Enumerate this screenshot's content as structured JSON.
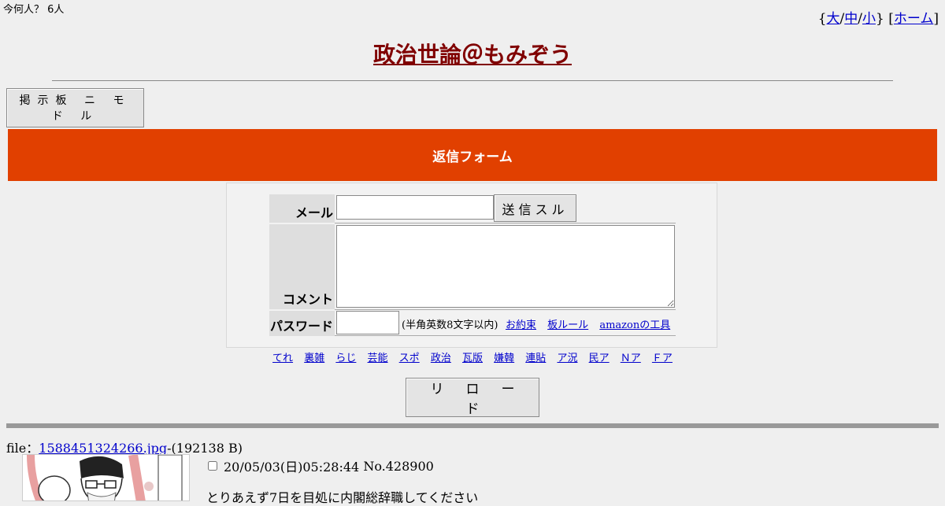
{
  "counter": {
    "text": "今何人？ 6人"
  },
  "top_nav": {
    "open_brace": "{",
    "size_large": "大",
    "sep1": "/",
    "size_medium": "中",
    "sep2": "/",
    "size_small": "小",
    "close_brace": "}",
    "open_bracket": "[",
    "home": "ホーム",
    "close_bracket": "]"
  },
  "board_title": "政治世論＠もみぞう",
  "mode_button": "掲示板 ニ モ ド ル",
  "reply_form": {
    "banner": "返信フォーム",
    "mail_label": "メール",
    "mail_value": "",
    "send_button": "送信スル",
    "comment_label": "コメント",
    "comment_value": "",
    "password_label": "パスワード",
    "password_value": "",
    "password_note": "(半角英数8文字以内)",
    "links": [
      "お約束",
      "板ルール",
      "amazonの工具"
    ]
  },
  "board_links": [
    "てれ",
    "裏雑",
    "らじ",
    "芸能",
    "スポ",
    "政治",
    "瓦版",
    "嫌韓",
    "連貼",
    "ア況",
    "民ア",
    "Ｎア",
    "Ｆア"
  ],
  "reload_button": "リロード",
  "post": {
    "file_prefix": "file：",
    "file_name": "1588451324266.jpg",
    "file_size": "-(192138 B)",
    "date": "20/05/03(日)05:28:44",
    "number": "No.428900",
    "body": "とりあえず7日を目処に内閣総辞職してください"
  },
  "colors": {
    "banner": "#e14000",
    "title": "#800000",
    "link": "#0000cc",
    "background": "#efefef"
  }
}
